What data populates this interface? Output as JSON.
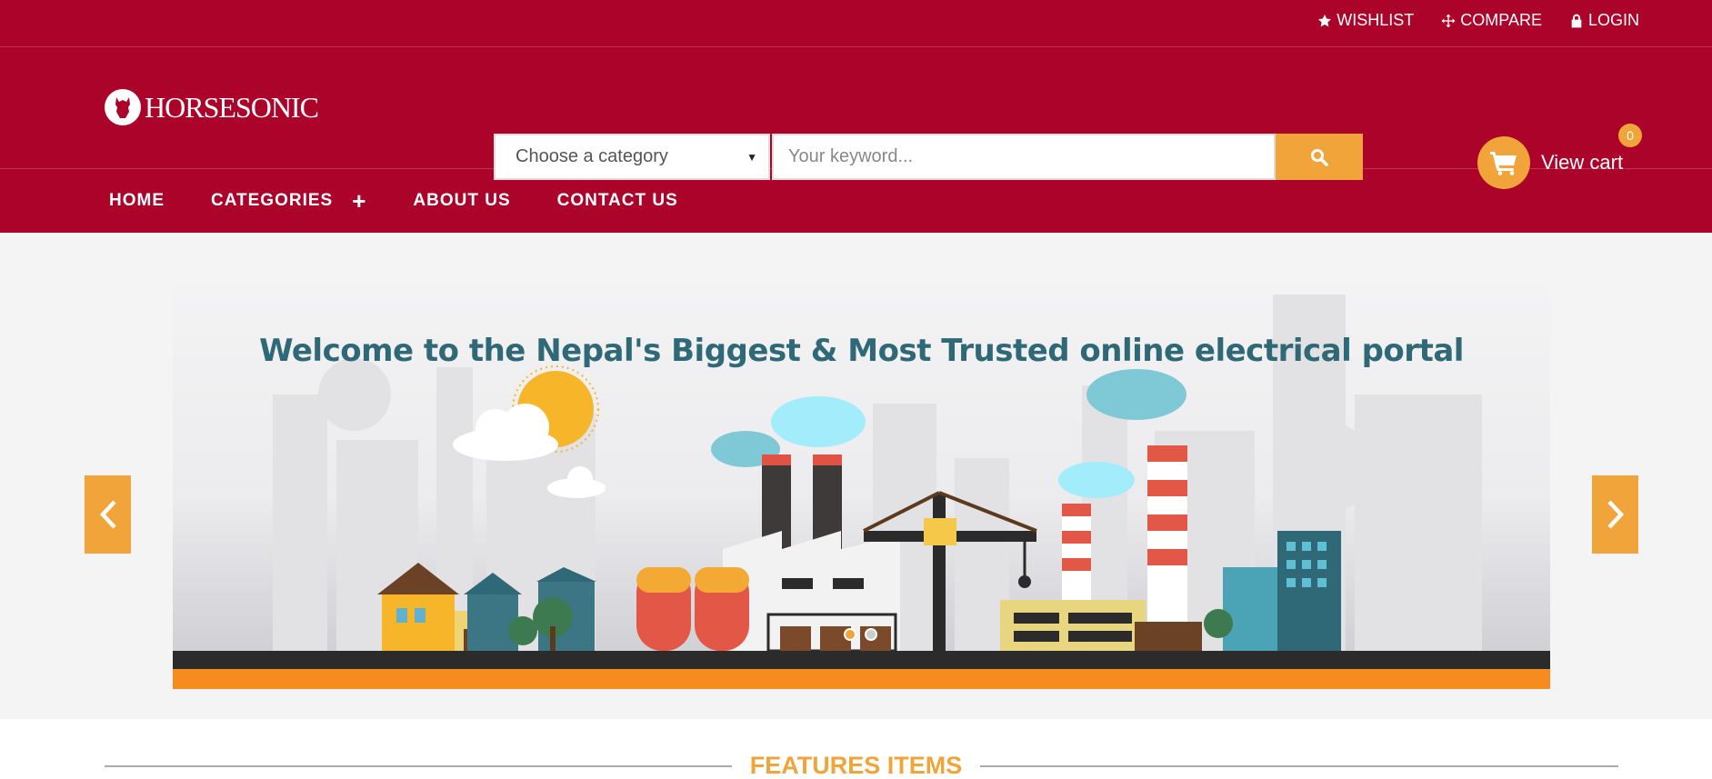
{
  "topbar": {
    "links": [
      {
        "icon": "star-icon",
        "label": "WISHLIST"
      },
      {
        "icon": "compare-icon",
        "label": "COMPARE"
      },
      {
        "icon": "lock-icon",
        "label": "LOGIN"
      }
    ]
  },
  "header": {
    "logo_text": "HORSESONIC",
    "category_select": "Choose a category",
    "keyword_placeholder": "Your keyword...",
    "cart_label": "View cart",
    "cart_count": "0"
  },
  "nav": {
    "items": [
      "HOME",
      "CATEGORIES",
      "ABOUT US",
      "CONTACT US"
    ]
  },
  "hero": {
    "headline": "Welcome to the Nepal's Biggest & Most Trusted online electrical portal",
    "slide_count": 2,
    "active_slide": 1
  },
  "features": {
    "title": "FEATURES ITEMS"
  },
  "colors": {
    "brand": "#ab0329",
    "accent": "#f0a43a",
    "hero_bg": "#f4f4f5",
    "headline": "#2f6876"
  }
}
